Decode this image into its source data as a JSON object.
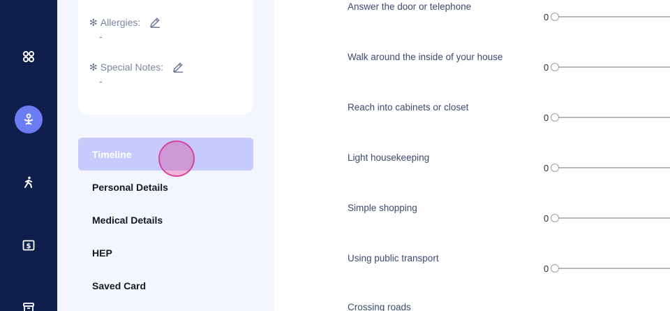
{
  "rail": {
    "items": [
      {
        "name": "grid-icon",
        "active": false
      },
      {
        "name": "patient-icon",
        "active": true
      },
      {
        "name": "exercise-icon",
        "active": false
      },
      {
        "name": "billing-icon",
        "active": false
      },
      {
        "name": "archive-icon",
        "active": false
      }
    ]
  },
  "card": {
    "fields": [
      {
        "label": "Allergies:",
        "value": "-"
      },
      {
        "label": "Special Notes:",
        "value": "-"
      }
    ]
  },
  "menu": {
    "items": [
      {
        "label": "Timeline",
        "active": true
      },
      {
        "label": "Personal Details",
        "active": false
      },
      {
        "label": "Medical Details",
        "active": false
      },
      {
        "label": "HEP",
        "active": false
      },
      {
        "label": "Saved Card",
        "active": false
      }
    ]
  },
  "questions": [
    {
      "text": "Answer the door or telephone",
      "value": "0"
    },
    {
      "text": "Walk around the inside of your house",
      "value": "0"
    },
    {
      "text": "Reach into cabinets or closet",
      "value": "0"
    },
    {
      "text": "Light housekeeping",
      "value": "0"
    },
    {
      "text": "Simple shopping",
      "value": "0"
    },
    {
      "text": "Using public transport",
      "value": "0"
    },
    {
      "text": "Crossing roads",
      "value": ""
    }
  ],
  "colors": {
    "rail": "#0e1f4d",
    "accent": "#6c7cf2",
    "active_menu": "#c6cbfb"
  }
}
